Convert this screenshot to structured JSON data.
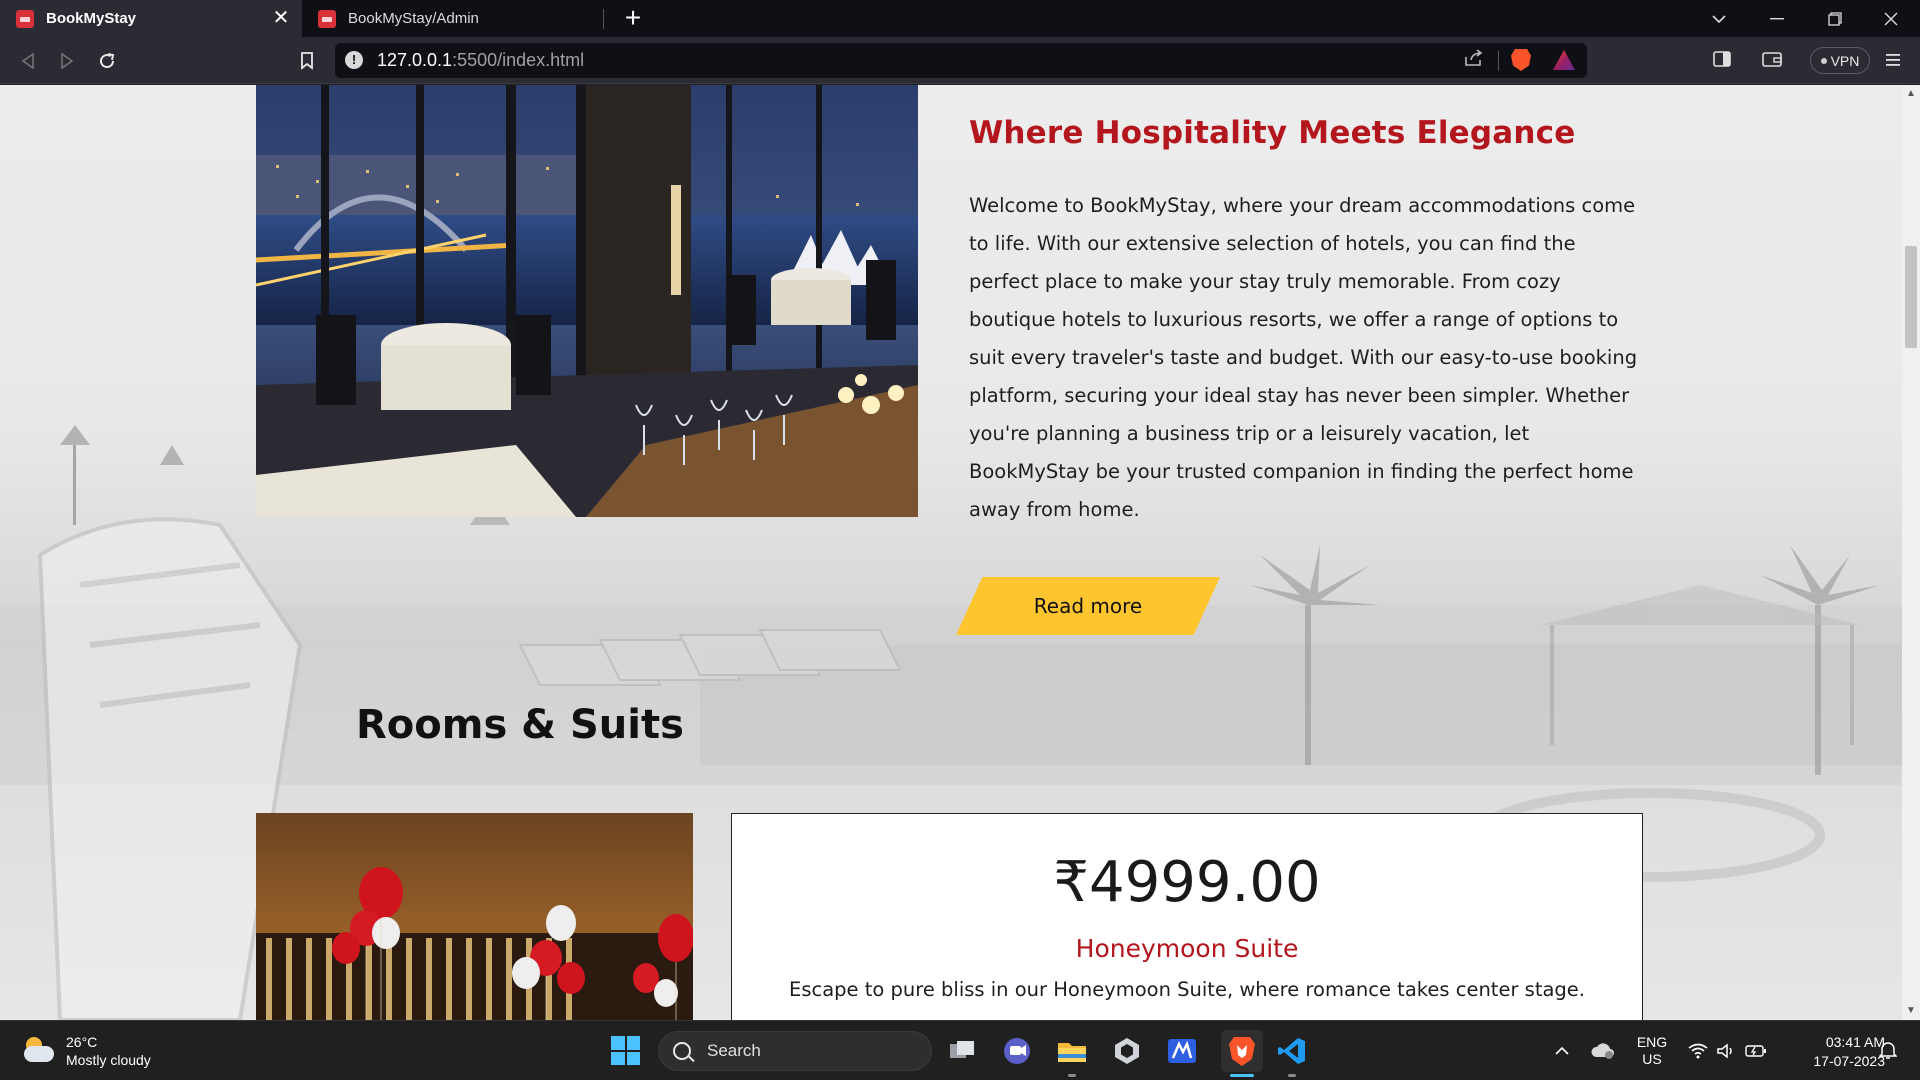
{
  "browser": {
    "tabs": [
      {
        "title": "BookMyStay",
        "active": true
      },
      {
        "title": "BookMyStay/Admin",
        "active": false
      }
    ],
    "tab_close_glyph": "✕",
    "new_tab_glyph": "+",
    "url": {
      "host": "127.0.0.1",
      "rest": ":5500/index.html"
    },
    "vpn_label": "VPN"
  },
  "page": {
    "about": {
      "title": "Where Hospitality Meets Elegance",
      "text": "Welcome to BookMyStay, where your dream accommodations come to life. With our extensive selection of hotels, you can find the perfect place to make your stay truly memorable. From cozy boutique hotels to luxurious resorts, we offer a range of options to suit every traveler's taste and budget. With our easy-to-use booking platform, securing your ideal stay has never been simpler. Whether you're planning a business trip or a leisurely vacation, let BookMyStay be your trusted companion in finding the perfect home away from home.",
      "button": "Read more"
    },
    "rooms": {
      "heading": "Rooms & Suits",
      "items": [
        {
          "price": "₹4999.00",
          "name": "Honeymoon Suite",
          "description": "Escape to pure bliss in our Honeymoon Suite, where romance takes center stage."
        }
      ]
    }
  },
  "taskbar": {
    "weather": {
      "temp": "26°C",
      "condition": "Mostly cloudy"
    },
    "search_label": "Search",
    "language": {
      "lang": "ENG",
      "region": "US"
    },
    "time": "03:41 AM",
    "date": "17-07-2023"
  },
  "colors": {
    "accent_red": "#b3161d",
    "button_yellow": "#fec52e",
    "tab_bar": "#0f1016",
    "toolbar": "#2b2c33"
  }
}
